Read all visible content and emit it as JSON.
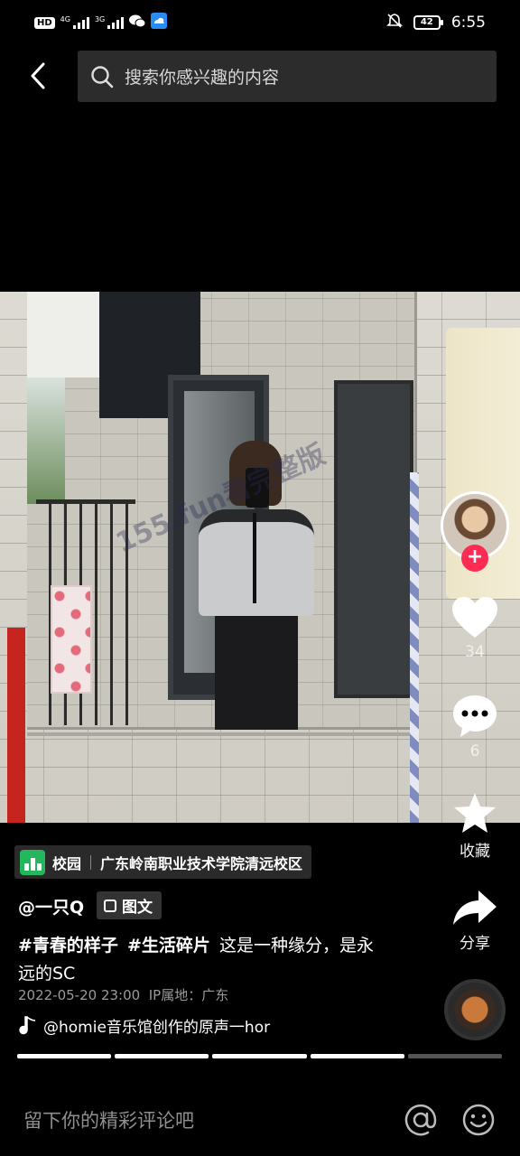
{
  "status_bar": {
    "left_badge": "HD",
    "network1": "4G",
    "network2": "3G",
    "battery": "42",
    "time": "6:55"
  },
  "search": {
    "placeholder": "搜索你感兴趣的内容"
  },
  "watermark": "155.fun看完整版",
  "actions": {
    "likes": "34",
    "comments": "6",
    "favorite_label": "收藏",
    "share_label": "分享",
    "follow_symbol": "+"
  },
  "location": {
    "category": "校园",
    "name": "广东岭南职业技术学院清远校区"
  },
  "post": {
    "author": "@一只Q",
    "type_badge": "图文",
    "hashtags": [
      "#青春的样子",
      "#生活碎片"
    ],
    "text": "这是一种缘分，是永远的SC",
    "datetime": "2022-05-20 23:00",
    "ip_location": "IP属地：广东"
  },
  "music": {
    "title": "@homie音乐馆创作的原声一hor"
  },
  "progress": {
    "total": 5,
    "current": 4
  },
  "comment_bar": {
    "placeholder": "留下你的精彩评论吧"
  },
  "colors": {
    "follow_red": "#fe2c55",
    "location_green": "#22b85b",
    "background": "#000000"
  }
}
